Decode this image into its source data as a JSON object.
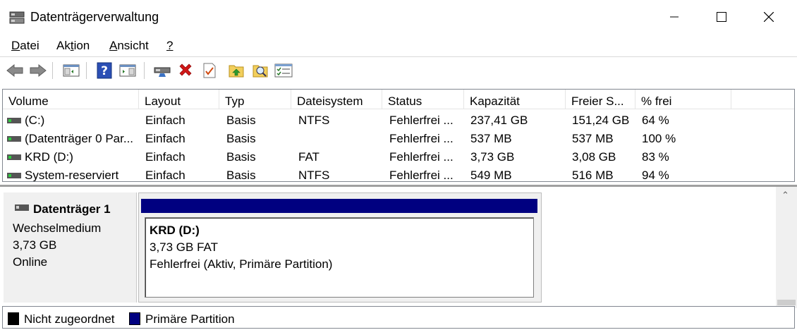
{
  "window": {
    "title": "Datenträgerverwaltung"
  },
  "menu": [
    {
      "pre": "",
      "u": "D",
      "post": "atei"
    },
    {
      "pre": "Ak",
      "u": "t",
      "post": "ion"
    },
    {
      "pre": "",
      "u": "A",
      "post": "nsicht"
    },
    {
      "pre": "",
      "u": "?",
      "post": ""
    }
  ],
  "toolbar": {
    "icons": [
      "back-arrow-icon",
      "forward-arrow-icon",
      "console-tree-icon",
      "help-icon",
      "show-hide-pane-icon",
      "connect-drive-icon",
      "delete-icon",
      "properties-check-icon",
      "up-level-folder-icon",
      "search-folder-icon",
      "list-view-icon"
    ]
  },
  "volume_list": {
    "columns": [
      "Volume",
      "Layout",
      "Typ",
      "Dateisystem",
      "Status",
      "Kapazität",
      "Freier S...",
      "% frei"
    ],
    "rows": [
      {
        "volume": " (C:)",
        "layout": "Einfach",
        "typ": "Basis",
        "dateisystem": "NTFS",
        "status": "Fehlerfrei ...",
        "kapazitaet": "237,41 GB",
        "frei": "151,24 GB",
        "prozent": "64 %"
      },
      {
        "volume": "(Datenträger 0 Par...",
        "layout": "Einfach",
        "typ": "Basis",
        "dateisystem": "",
        "status": "Fehlerfrei ...",
        "kapazitaet": "537 MB",
        "frei": "537 MB",
        "prozent": "100 %"
      },
      {
        "volume": "KRD (D:)",
        "layout": "Einfach",
        "typ": "Basis",
        "dateisystem": "FAT",
        "status": "Fehlerfrei ...",
        "kapazitaet": "3,73 GB",
        "frei": "3,08 GB",
        "prozent": "83 %"
      },
      {
        "volume": "System-reserviert",
        "layout": "Einfach",
        "typ": "Basis",
        "dateisystem": "NTFS",
        "status": "Fehlerfrei ...",
        "kapazitaet": "549 MB",
        "frei": "516 MB",
        "prozent": "94 %"
      }
    ]
  },
  "disk": {
    "name": "Datenträger 1",
    "type": "Wechselmedium",
    "size": "3,73 GB",
    "state": "Online"
  },
  "partition": {
    "title": "KRD  (D:)",
    "size_fs": "3,73 GB FAT",
    "status": "Fehlerfrei (Aktiv, Primäre Partition)",
    "color": "#000080"
  },
  "legend": [
    {
      "label": "Nicht zugeordnet",
      "color": "#000000"
    },
    {
      "label": "Primäre Partition",
      "color": "#000080"
    }
  ]
}
